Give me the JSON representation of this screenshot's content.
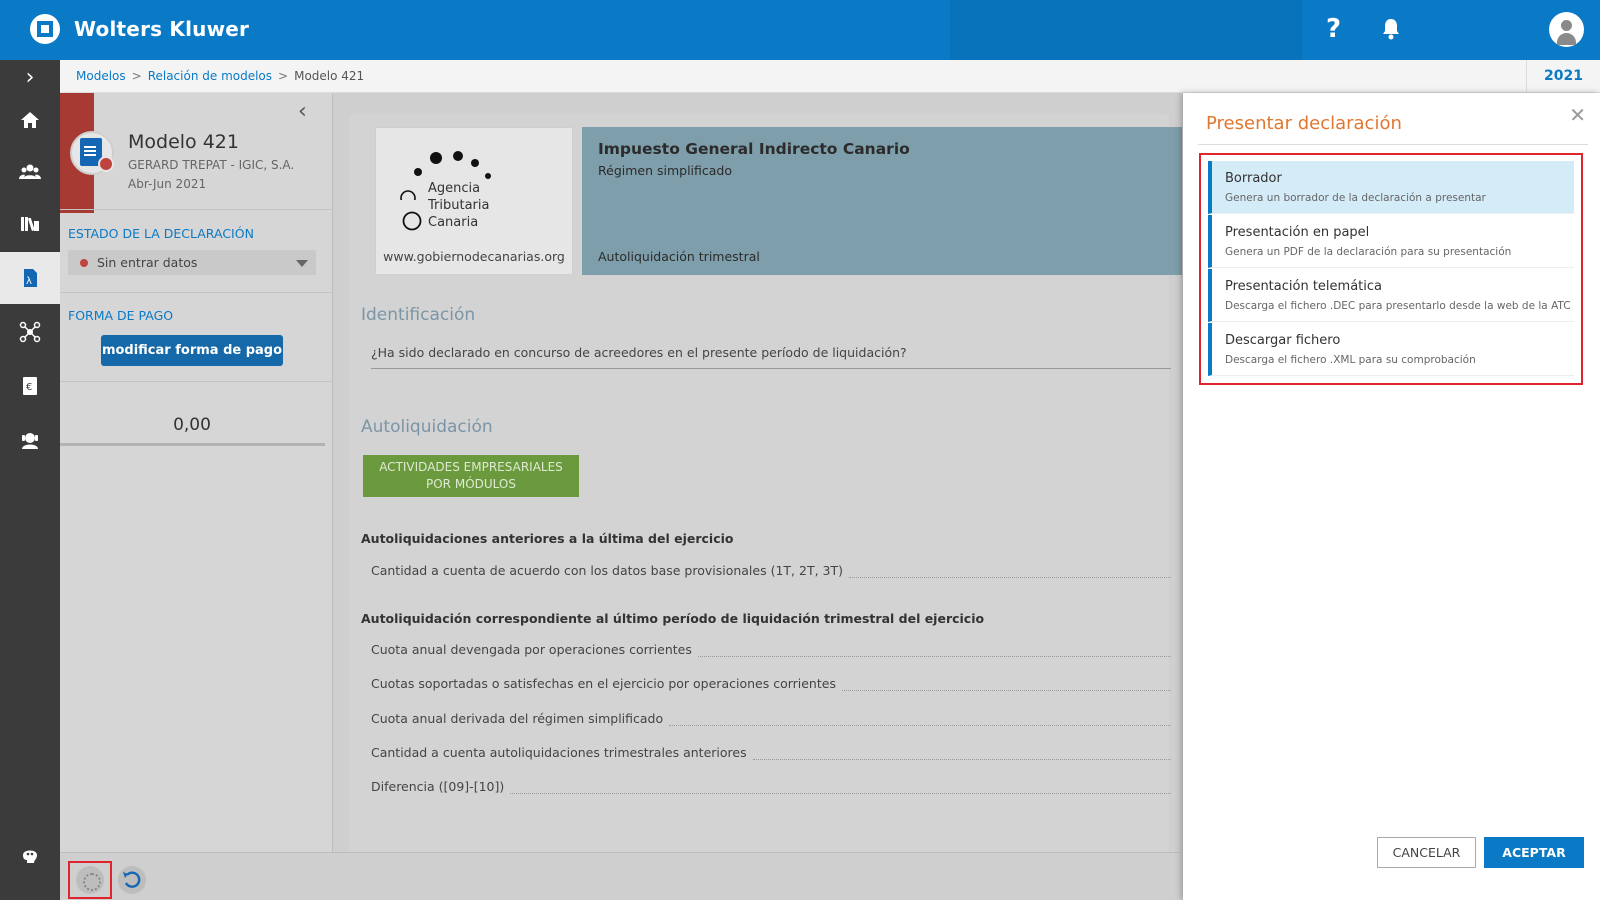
{
  "header": {
    "brand": "Wolters Kluwer",
    "help_icon_glyph": "?",
    "icons": [
      "wolters-kluwer-logo-icon",
      "help-icon",
      "bell-icon",
      "user-avatar-icon"
    ],
    "brand_color": "#0a7ac6"
  },
  "nav": {
    "expand_glyph": "›",
    "items": [
      "home-icon",
      "users-icon",
      "library-icon",
      "tax-document-icon",
      "network-icon",
      "euro-icon",
      "support-icon",
      "brain-icon"
    ]
  },
  "breadcrumb": {
    "items": [
      "Modelos",
      "Relación de modelos",
      "Modelo 421"
    ],
    "separator": ">",
    "year": "2021"
  },
  "info": {
    "collapse_glyph": "‹",
    "title": "Modelo 421",
    "company": "GERARD TREPAT - IGIC, S.A.",
    "period": "Abr-Jun  2021",
    "status_label": "ESTADO DE LA DECLARACIÓN",
    "status_value": "Sin entrar datos",
    "payment_label": "FORMA DE PAGO",
    "payment_button": "modificar forma de pago",
    "amount": "0,00"
  },
  "main": {
    "agency": {
      "line1": "Agencia",
      "line2": "Tributaria",
      "line3": "Canaria",
      "url": "www.gobiernodecanarias.org"
    },
    "tax": {
      "title": "Impuesto General Indirecto Canario",
      "subtitle": "Régimen simplificado",
      "footer": "Autoliquidación trimestral"
    },
    "identificacion_heading": "Identificación",
    "question": "¿Ha sido declarado en concurso de acreedores en el presente período de liquidación?",
    "autoliquidacion_heading": "Autoliquidación",
    "activity_button_line1": "ACTIVIDADES EMPRESARIALES",
    "activity_button_line2": "POR MÓDULOS",
    "subheading1": "Autoliquidaciones anteriores a la última del ejercicio",
    "row1": "Cantidad a cuenta de acuerdo con los datos base provisionales (1T, 2T, 3T)",
    "subheading2": "Autoliquidación correspondiente al último período de liquidación trimestral del ejercicio",
    "rows": [
      "Cuota anual devengada por operaciones corrientes",
      "Cuotas soportadas o satisfechas en el ejercicio por operaciones corrientes",
      "Cuota anual derivada del régimen simplificado",
      "Cantidad a cuenta autoliquidaciones trimestrales anteriores",
      "Diferencia ([09]-[10])"
    ]
  },
  "panel": {
    "title": "Presentar declaración",
    "close_glyph": "✕",
    "options": [
      {
        "title": "Borrador",
        "desc": "Genera un borrador de la declaración a presentar",
        "selected": true
      },
      {
        "title": "Presentación en papel",
        "desc": "Genera un PDF de la declaración para su presentación",
        "selected": false
      },
      {
        "title": "Presentación telemática",
        "desc": "Descarga el fichero .DEC para presentarlo desde la web de la ATC",
        "selected": false
      },
      {
        "title": "Descargar fichero",
        "desc": "Descarga el fichero .XML para su comprobación",
        "selected": false
      }
    ],
    "cancel": "CANCELAR",
    "accept": "ACEPTAR",
    "title_color": "#e27730",
    "highlight_color": "#e0242d"
  },
  "bottom": {
    "icons": [
      "settings-gear-icon",
      "undo-icon"
    ]
  }
}
